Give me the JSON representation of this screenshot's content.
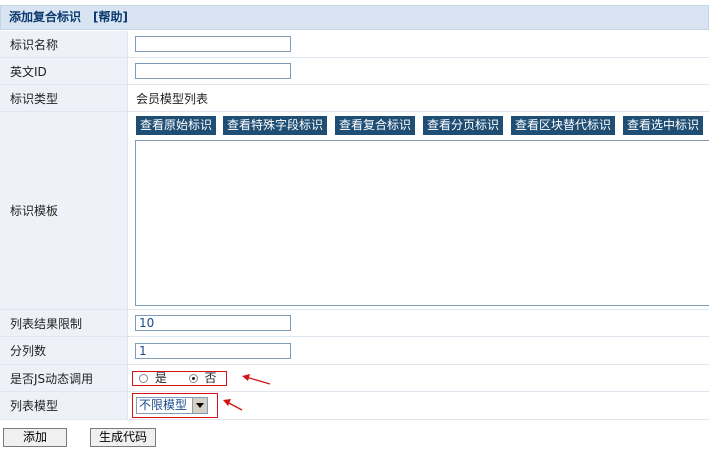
{
  "title": "添加复合标识",
  "help_link": "[帮助]",
  "fields": {
    "name_label": "标识名称",
    "name_value": "",
    "english_id_label": "英文ID",
    "english_id_value": "",
    "type_label": "标识类型",
    "type_value": "会员模型列表",
    "template_label": "标识模板",
    "template_value": "",
    "limit_label": "列表结果限制",
    "limit_value": "10",
    "columns_label": "分列数",
    "columns_value": "1",
    "js_label": "是否JS动态调用",
    "js_yes": "是",
    "js_no": "否",
    "js_selected": "否",
    "model_label": "列表模型",
    "model_selected": "不限模型"
  },
  "tag_buttons": [
    "查看原始标识",
    "查看特殊字段标识",
    "查看复合标识",
    "查看分页标识",
    "查看区块替代标识",
    "查看选中标识"
  ],
  "actions": {
    "add": "添加",
    "generate": "生成代码"
  },
  "colors": {
    "annotation_red": "#d21414",
    "header_bg": "#d8e4f2",
    "tag_button_bg": "#1f4e74"
  }
}
